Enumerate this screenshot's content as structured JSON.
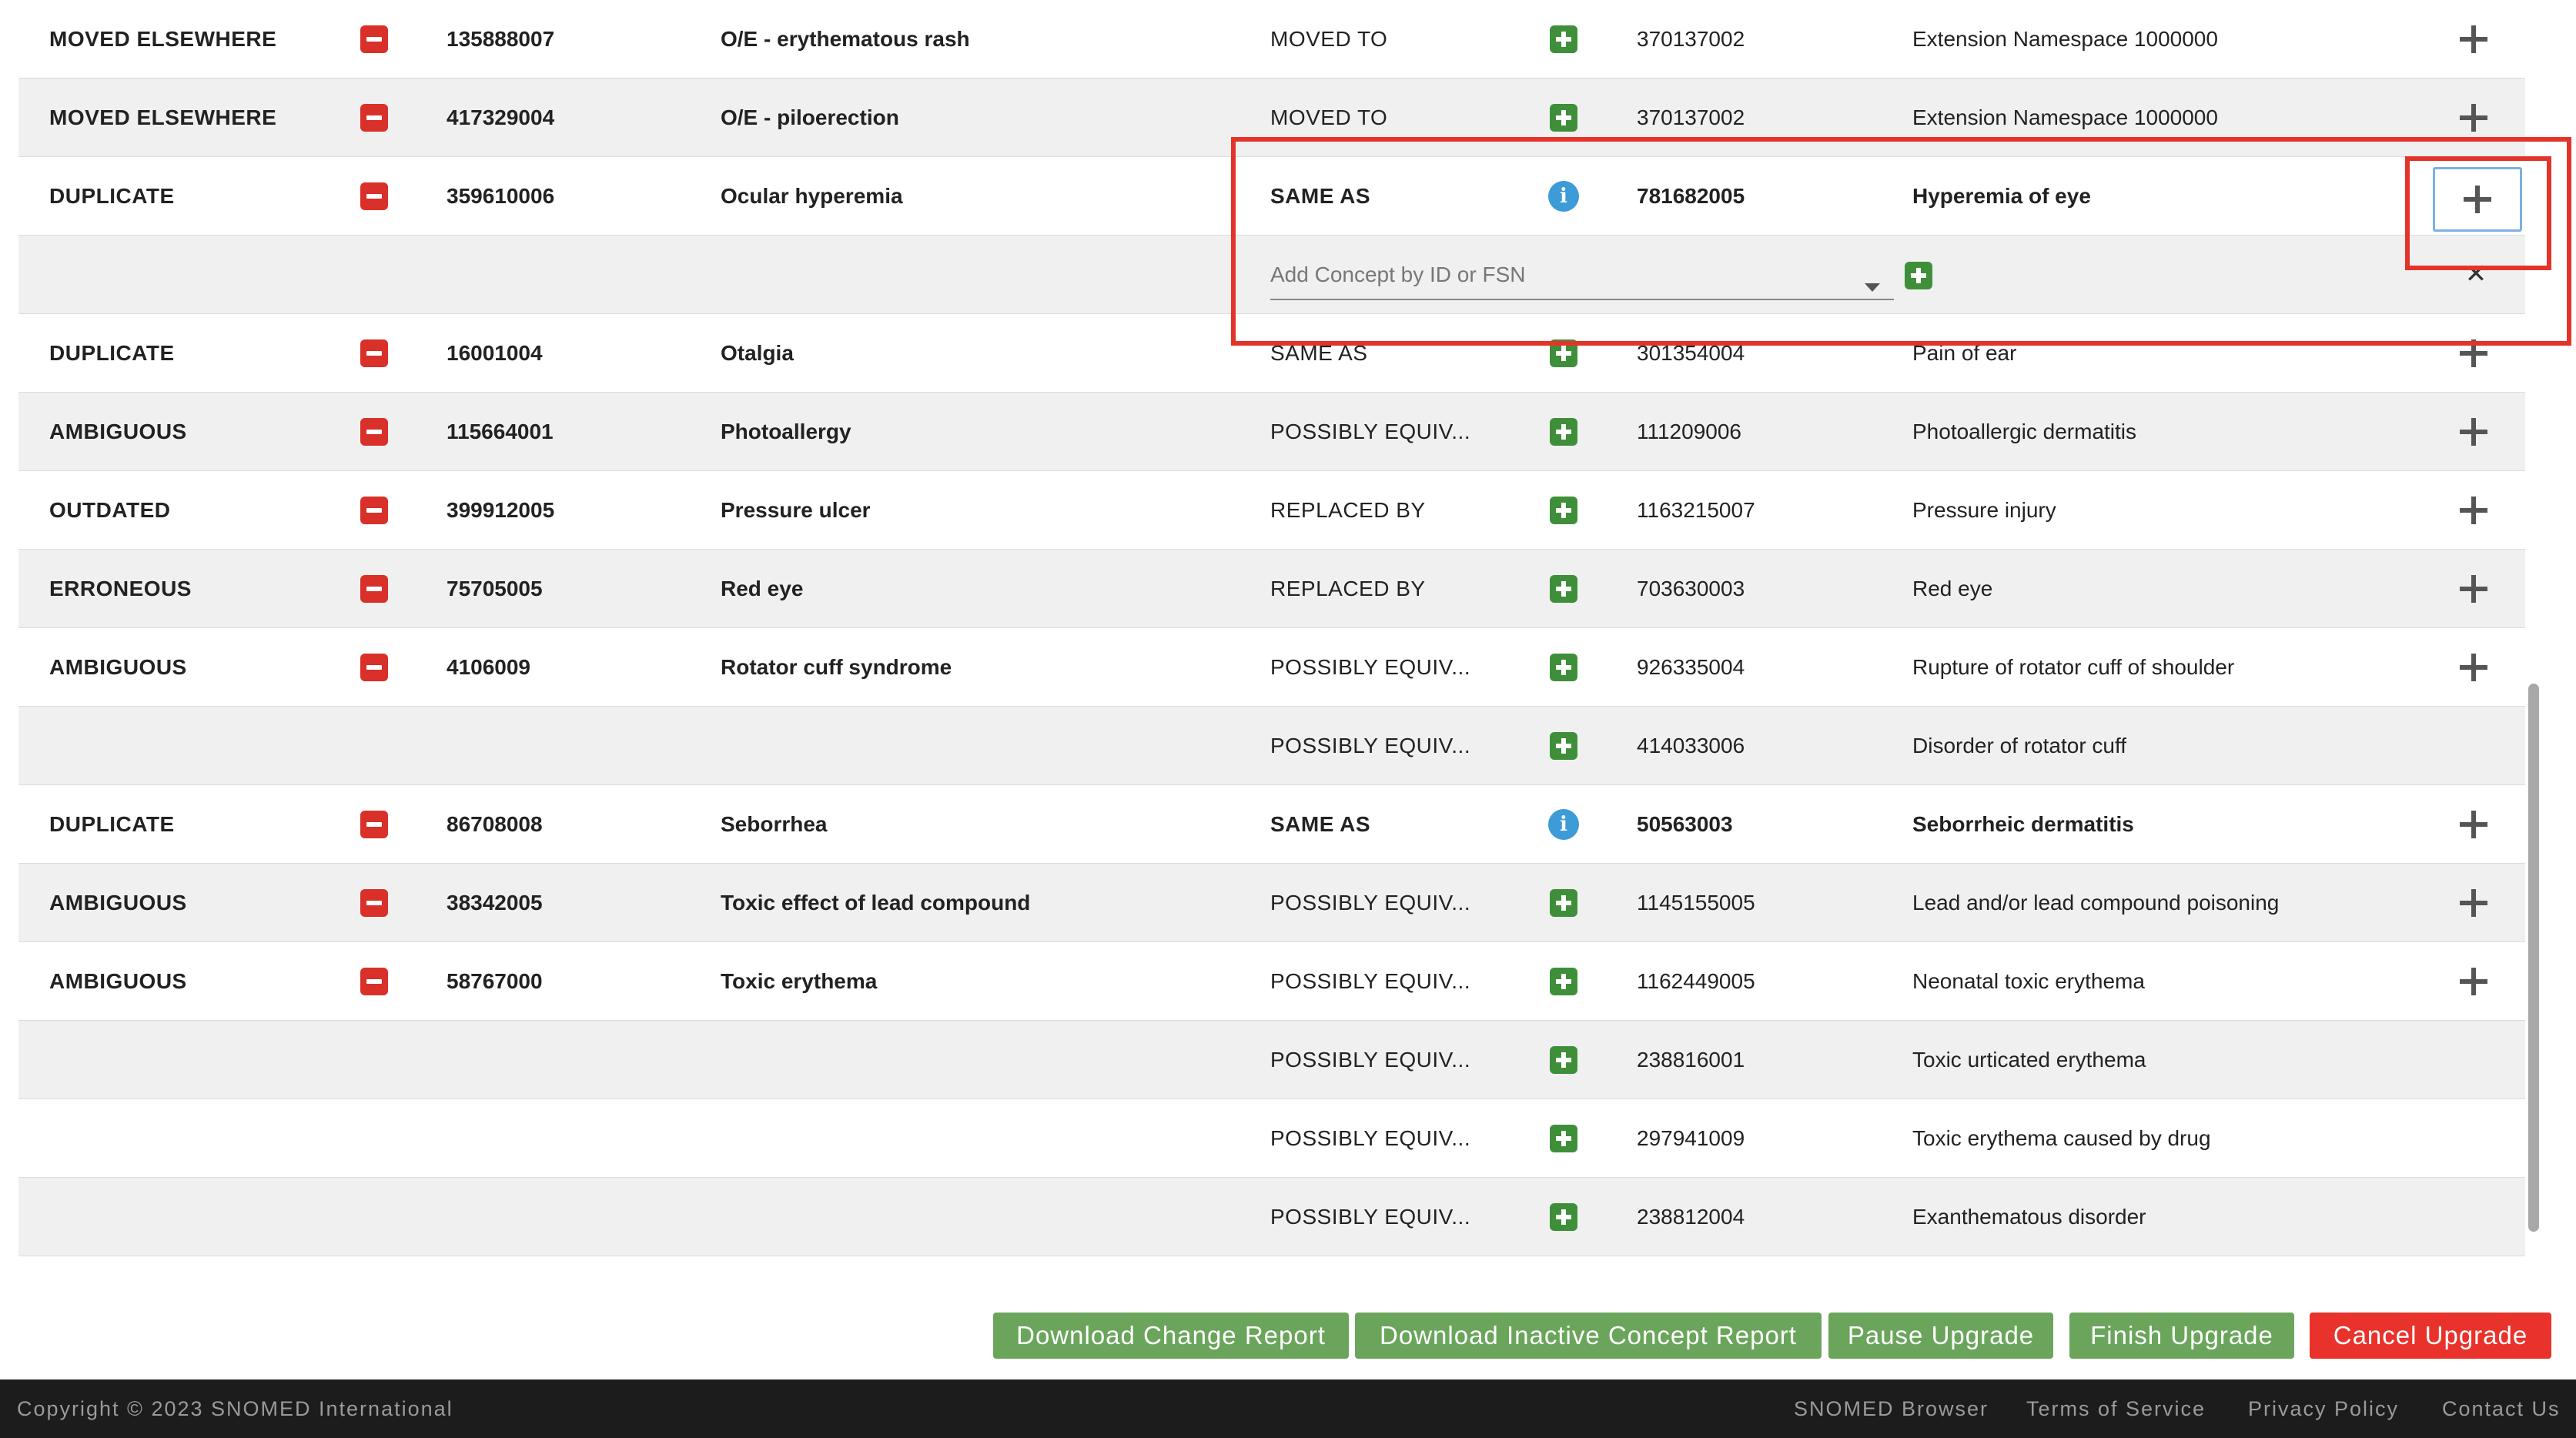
{
  "rows": [
    {
      "type": "data",
      "status": "MOVED ELSEWHERE",
      "concept_id": "135888007",
      "concept_name": "O/E - erythematous rash",
      "association": "MOVED TO",
      "target_id": "370137002",
      "target_name": "Extension Namespace 1000000",
      "action_icon": "green-plus",
      "emphasis": false
    },
    {
      "type": "data",
      "status": "MOVED ELSEWHERE",
      "concept_id": "417329004",
      "concept_name": "O/E - piloerection",
      "association": "MOVED TO",
      "target_id": "370137002",
      "target_name": "Extension Namespace 1000000",
      "action_icon": "green-plus",
      "emphasis": false
    },
    {
      "type": "data",
      "status": "DUPLICATE",
      "concept_id": "359610006",
      "concept_name": "Ocular hyperemia",
      "association": "SAME AS",
      "target_id": "781682005",
      "target_name": "Hyperemia of eye",
      "action_icon": "info",
      "emphasis": true,
      "selected": true
    },
    {
      "type": "add",
      "placeholder": "Add Concept by ID or FSN",
      "close_symbol": "✕"
    },
    {
      "type": "data",
      "status": "DUPLICATE",
      "concept_id": "16001004",
      "concept_name": "Otalgia",
      "association": "SAME AS",
      "target_id": "301354004",
      "target_name": "Pain of ear",
      "action_icon": "green-plus",
      "emphasis": false
    },
    {
      "type": "data",
      "status": "AMBIGUOUS",
      "concept_id": "115664001",
      "concept_name": "Photoallergy",
      "association": "POSSIBLY EQUIV...",
      "target_id": "111209006",
      "target_name": "Photoallergic dermatitis",
      "action_icon": "green-plus",
      "emphasis": false
    },
    {
      "type": "data",
      "status": "OUTDATED",
      "concept_id": "399912005",
      "concept_name": "Pressure ulcer",
      "association": "REPLACED BY",
      "target_id": "1163215007",
      "target_name": "Pressure injury",
      "action_icon": "green-plus",
      "emphasis": false
    },
    {
      "type": "data",
      "status": "ERRONEOUS",
      "concept_id": "75705005",
      "concept_name": "Red eye",
      "association": "REPLACED BY",
      "target_id": "703630003",
      "target_name": "Red eye",
      "action_icon": "green-plus",
      "emphasis": false
    },
    {
      "type": "data",
      "status": "AMBIGUOUS",
      "concept_id": "4106009",
      "concept_name": "Rotator cuff syndrome",
      "association": "POSSIBLY EQUIV...",
      "target_id": "926335004",
      "target_name": "Rupture of rotator cuff of shoulder",
      "action_icon": "green-plus",
      "emphasis": false
    },
    {
      "type": "sub",
      "association": "POSSIBLY EQUIV...",
      "target_id": "414033006",
      "target_name": "Disorder of rotator cuff"
    },
    {
      "type": "data",
      "status": "DUPLICATE",
      "concept_id": "86708008",
      "concept_name": "Seborrhea",
      "association": "SAME AS",
      "target_id": "50563003",
      "target_name": "Seborrheic dermatitis",
      "action_icon": "info",
      "emphasis": true
    },
    {
      "type": "data",
      "status": "AMBIGUOUS",
      "concept_id": "38342005",
      "concept_name": "Toxic effect of lead compound",
      "association": "POSSIBLY EQUIV...",
      "target_id": "1145155005",
      "target_name": "Lead and/or lead compound poisoning",
      "action_icon": "green-plus",
      "emphasis": false
    },
    {
      "type": "data",
      "status": "AMBIGUOUS",
      "concept_id": "58767000",
      "concept_name": "Toxic erythema",
      "association": "POSSIBLY EQUIV...",
      "target_id": "1162449005",
      "target_name": "Neonatal toxic erythema",
      "action_icon": "green-plus",
      "emphasis": false
    },
    {
      "type": "sub",
      "association": "POSSIBLY EQUIV...",
      "target_id": "238816001",
      "target_name": "Toxic urticated erythema"
    },
    {
      "type": "sub",
      "association": "POSSIBLY EQUIV...",
      "target_id": "297941009",
      "target_name": "Toxic erythema caused by drug"
    },
    {
      "type": "sub",
      "association": "POSSIBLY EQUIV...",
      "target_id": "238812004",
      "target_name": "Exanthematous disorder"
    }
  ],
  "buttons": {
    "download_change_report": "Download Change Report",
    "download_inactive_report": "Download Inactive Concept Report",
    "pause_upgrade": "Pause Upgrade",
    "finish_upgrade": "Finish Upgrade",
    "cancel_upgrade": "Cancel Upgrade"
  },
  "footer": {
    "copyright": "Copyright © 2023 SNOMED International",
    "links": [
      "SNOMED Browser",
      "Terms of Service",
      "Privacy Policy",
      "Contact Us"
    ]
  },
  "colors": {
    "remove_red": "#d9302a",
    "add_green": "#3f8f3a",
    "info_blue": "#3d9bd7",
    "annotation_red": "#e4342a",
    "button_green": "#6aa55b",
    "cancel_red": "#e8322b",
    "footer_bg": "#1c1c1c"
  },
  "icons": {
    "remove": "minus-icon",
    "add": "plus-icon",
    "info": "info-icon",
    "row_add": "add-row-icon",
    "close": "close-icon"
  }
}
